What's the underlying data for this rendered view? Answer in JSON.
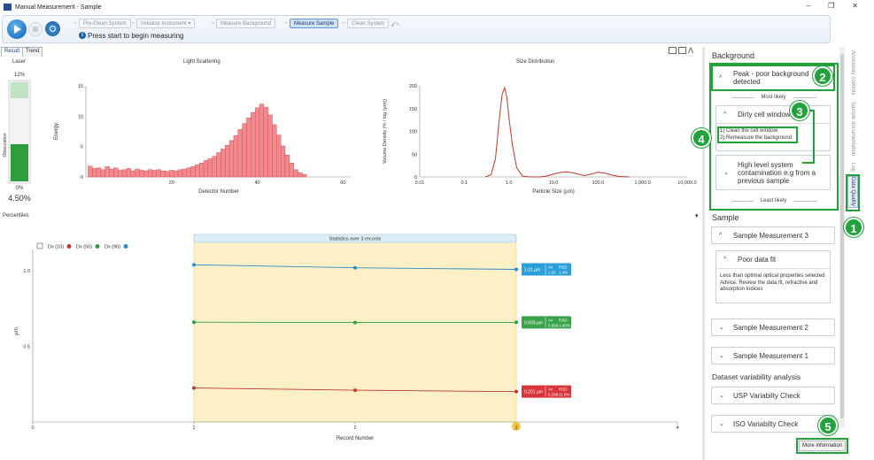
{
  "window": {
    "title": "Manual Measurement - Sample",
    "controls": [
      "–",
      "❐",
      "✕"
    ]
  },
  "toolbar": {
    "steps": [
      {
        "label": "Pre-Clean System",
        "active": false
      },
      {
        "label": "Initialise Instrument ▾",
        "active": false
      },
      {
        "label": "Measure Background",
        "active": false
      },
      {
        "label": "Measure Sample",
        "active": true
      },
      {
        "label": "Clean System",
        "active": false
      }
    ],
    "status": "Press start to begin measuring"
  },
  "tabs": [
    "Result",
    "Trend"
  ],
  "laser": {
    "title": "Laser",
    "top_label": "12%",
    "bottom_label": "0%",
    "axis_label": "Obscuration",
    "value": "4.50%",
    "fill_fraction": 0.375
  },
  "light_scattering": {
    "title": "Light Scattering",
    "xlabel": "Detector Number",
    "ylabel": "Energy"
  },
  "size_distribution": {
    "title": "Size Distribution",
    "xlabel": "Particle Size (µm)",
    "ylabel": "Volume Density (% / log (µm))"
  },
  "percentiles": {
    "title": "Percentiles",
    "stats_banner": "Statistics over 3 records",
    "xlabel": "Record Number",
    "ylabel": "µm",
    "legend": [
      "Dx (10)",
      "Dx (50)",
      "Dx (90)"
    ],
    "badges": [
      {
        "value": "1.01 µm",
        "av_label": "Av",
        "rsd_label": "RSD",
        "av": "1.02",
        "rsd": "1.4%",
        "color": "#2b9fd9"
      },
      {
        "value": "0.659 µm",
        "av_label": "Av",
        "rsd_label": "RSD",
        "av": "0.659",
        "rsd": "1.45%",
        "color": "#3aa34a"
      },
      {
        "value": "0.201 µm",
        "av_label": "Av",
        "rsd_label": "RSD",
        "av": "0.208",
        "rsd": "11.6%",
        "color": "#d9343a"
      }
    ],
    "current_record": "3"
  },
  "chart_data": [
    {
      "type": "bar",
      "title": "Light Scattering",
      "xlabel": "Detector Number",
      "ylabel": "Energy",
      "xlim": [
        0,
        62
      ],
      "ylim": [
        0,
        15
      ],
      "xticks": [
        20,
        40,
        60
      ],
      "yticks": [
        0,
        5,
        10,
        15
      ],
      "x": [
        1,
        2,
        3,
        4,
        5,
        6,
        7,
        8,
        9,
        10,
        11,
        12,
        13,
        14,
        15,
        16,
        17,
        18,
        19,
        20,
        21,
        22,
        23,
        24,
        25,
        26,
        27,
        28,
        29,
        30,
        31,
        32,
        33,
        34,
        35,
        36,
        37,
        38,
        39,
        40,
        41,
        42,
        43,
        44,
        45,
        46,
        47,
        48,
        49,
        50,
        51
      ],
      "values": [
        1.8,
        1.4,
        1.5,
        1.2,
        1.7,
        1.3,
        1.5,
        1.1,
        1.2,
        1.4,
        1.0,
        1.3,
        1.1,
        1.0,
        1.2,
        1.1,
        1.2,
        1.0,
        0.9,
        1.1,
        1.0,
        1.2,
        1.3,
        1.5,
        1.7,
        2.0,
        2.3,
        2.7,
        3.0,
        3.4,
        4.0,
        4.6,
        5.2,
        6.0,
        6.8,
        7.8,
        8.8,
        9.7,
        10.6,
        11.4,
        12.0,
        11.5,
        10.2,
        8.6,
        6.9,
        5.1,
        3.6,
        2.3,
        1.2,
        0.7,
        0.4
      ]
    },
    {
      "type": "line",
      "title": "Size Distribution",
      "xlabel": "Particle Size (µm)",
      "ylabel": "Volume Density (% / log (µm))",
      "xscale": "log",
      "xlim": [
        0.01,
        10000
      ],
      "ylim": [
        0,
        200
      ],
      "xticks": [
        "0.01",
        "0.1",
        "1.0",
        "10.0",
        "100.0",
        "1,000.0",
        "10,000.0"
      ],
      "yticks": [
        0,
        50,
        100,
        150,
        200
      ],
      "x": [
        0.3,
        0.4,
        0.5,
        0.6,
        0.7,
        0.8,
        0.9,
        1.0,
        1.2,
        1.5,
        2,
        3,
        5,
        7,
        10,
        15,
        20,
        30,
        50,
        70,
        100,
        150,
        200,
        300,
        500
      ],
      "values": [
        0,
        5,
        40,
        120,
        180,
        196,
        175,
        130,
        70,
        20,
        2,
        0,
        0,
        2,
        6,
        10,
        11,
        8,
        3,
        6,
        10,
        8,
        4,
        1,
        0
      ]
    },
    {
      "type": "line",
      "title": "Percentiles",
      "xlabel": "Record Number",
      "ylabel": "µm",
      "xlim": [
        0,
        4
      ],
      "ylim": [
        0,
        1.2
      ],
      "xticks": [
        0,
        1,
        2,
        3,
        4
      ],
      "yticks": [
        "0.5",
        "1.0"
      ],
      "x": [
        1,
        2,
        3
      ],
      "series": [
        {
          "name": "Dx (10)",
          "values": [
            0.225,
            0.21,
            0.201
          ],
          "color": "#c0392b"
        },
        {
          "name": "Dx (50)",
          "values": [
            0.66,
            0.658,
            0.659
          ],
          "color": "#2e9e3d"
        },
        {
          "name": "Dx (90)",
          "values": [
            1.04,
            1.02,
            1.01
          ],
          "color": "#2b8fc6"
        }
      ]
    }
  ],
  "right_panel": {
    "background_header": "Background",
    "peak_card": "Peak - poor background detected",
    "most_likely": "Most likely",
    "least_likely": "Least likely",
    "dirty_cell": "Dirty cell window",
    "dirty_cell_advice": [
      "1) Clean the cell window",
      "2) Remeasure the background"
    ],
    "high_level": "High level system contamination e.g from a previous sample",
    "sample_header": "Sample",
    "sample_measurement_3": "Sample Measurement 3",
    "poor_fit": "Poor data fit",
    "poor_fit_advice": "Less than optimal optical properties selected Advice: Review the data fit, refractive and absorption indices",
    "sample_measurement_2": "Sample Measurement 2",
    "sample_measurement_1": "Sample Measurement 1",
    "dataset_header": "Dataset variability analysis",
    "usp_check": "USP Variabilty Check",
    "iso_check": "ISO Variabilty Check",
    "more_info": "More information"
  },
  "side_tabs": [
    "Accessory controls",
    "Sample documentation",
    "Log",
    "Data Quality"
  ],
  "callouts": [
    "1",
    "2",
    "3",
    "4",
    "5"
  ]
}
